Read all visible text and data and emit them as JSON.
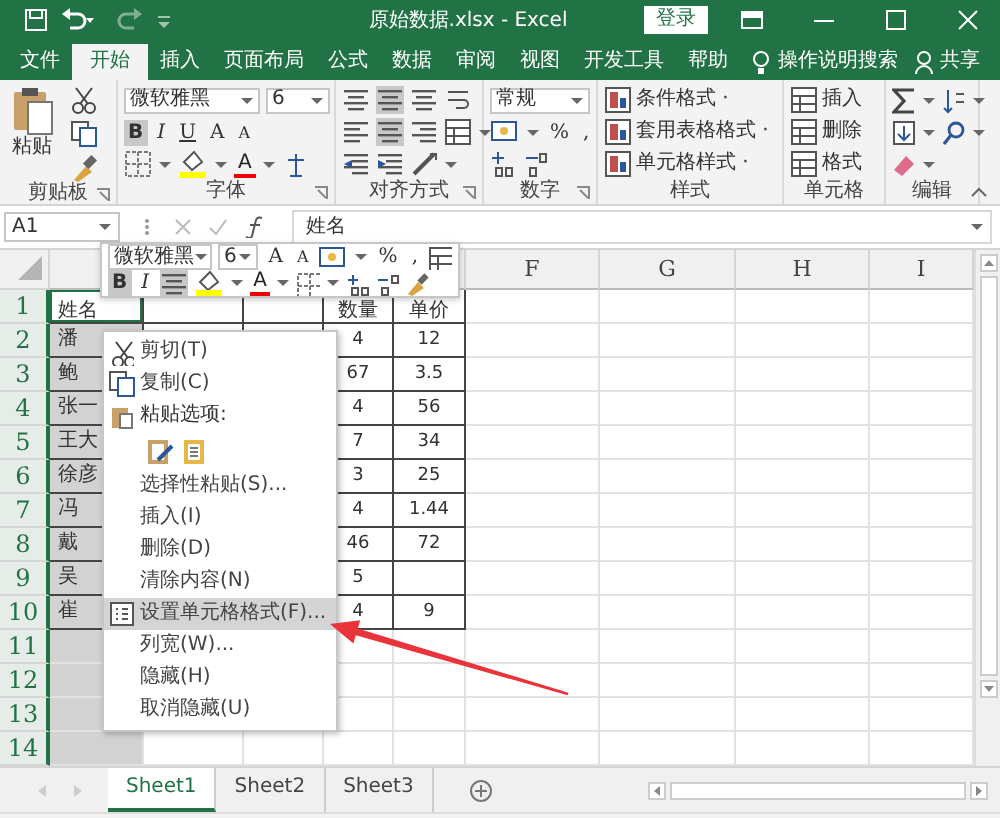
{
  "window": {
    "title": "原始数据.xlsx - Excel",
    "login_button": "登录"
  },
  "menu_tabs": [
    {
      "label": "文件",
      "selected": false
    },
    {
      "label": "开始",
      "selected": true
    },
    {
      "label": "插入",
      "selected": false
    },
    {
      "label": "页面布局",
      "selected": false
    },
    {
      "label": "公式",
      "selected": false
    },
    {
      "label": "数据",
      "selected": false
    },
    {
      "label": "审阅",
      "selected": false
    },
    {
      "label": "视图",
      "selected": false
    },
    {
      "label": "开发工具",
      "selected": false
    },
    {
      "label": "帮助",
      "selected": false
    }
  ],
  "search": {
    "label": "操作说明搜索"
  },
  "share": {
    "label": "共享"
  },
  "ribbon": {
    "groups": [
      {
        "kind": "clipboard",
        "label": "剪贴板",
        "paste": "粘贴"
      },
      {
        "kind": "font",
        "label": "字体",
        "font": "微软雅黑",
        "size": "6",
        "styles": [
          {
            "label": "B",
            "selected": true
          },
          {
            "label": "I",
            "selected": false
          },
          {
            "label": "U",
            "selected": false
          }
        ],
        "grow": "A",
        "shrink": "A",
        "color_letter": "A"
      },
      {
        "kind": "align",
        "label": "对齐方式"
      },
      {
        "kind": "number",
        "label": "数字",
        "format": "常规",
        "percent": "%",
        "comma": ","
      },
      {
        "kind": "styles",
        "label": "样式",
        "items": [
          "条件格式 ·",
          "套用表格格式 ·",
          "单元格样式 ·"
        ]
      },
      {
        "kind": "cells",
        "label": "单元格",
        "items": [
          "插入",
          "删除",
          "格式"
        ]
      },
      {
        "kind": "edit",
        "label": "编辑"
      }
    ]
  },
  "formula_bar": {
    "name_box": "A1",
    "value": "姓名"
  },
  "visible_column_headers": [
    "F",
    "G",
    "H",
    "I"
  ],
  "rows": [
    {
      "header": "1",
      "cells": [
        "姓名",
        null,
        null,
        "数量",
        "单价"
      ]
    },
    {
      "header": "2",
      "cells": [
        "潘",
        null,
        null,
        "4",
        "12"
      ]
    },
    {
      "header": "3",
      "cells": [
        "鲍",
        null,
        null,
        "67",
        "3.5"
      ]
    },
    {
      "header": "4",
      "cells": [
        "张一",
        null,
        null,
        "4",
        "56"
      ]
    },
    {
      "header": "5",
      "cells": [
        "王大",
        null,
        null,
        "7",
        "34"
      ]
    },
    {
      "header": "6",
      "cells": [
        "徐彦",
        null,
        null,
        "3",
        "25"
      ]
    },
    {
      "header": "7",
      "cells": [
        "冯",
        null,
        null,
        "4",
        "1.44"
      ]
    },
    {
      "header": "8",
      "cells": [
        "戴",
        null,
        null,
        "46",
        "72"
      ]
    },
    {
      "header": "9",
      "cells": [
        "吴",
        null,
        null,
        "5",
        null
      ]
    },
    {
      "header": "10",
      "cells": [
        "崔",
        null,
        null,
        "4",
        "9"
      ]
    },
    {
      "header": "11"
    },
    {
      "header": "12"
    },
    {
      "header": "13"
    },
    {
      "header": "14"
    }
  ],
  "mini_toolbar": {
    "font": "微软雅黑",
    "size": "6",
    "grow": "A",
    "shrink": "A",
    "percent": "%",
    "comma": ",",
    "bold": {
      "label": "B",
      "selected": true
    },
    "italic": {
      "label": "I",
      "selected": false
    },
    "center_selected": true,
    "color_letter": "A"
  },
  "context_menu": [
    {
      "kind": "item",
      "label": "剪切(T)",
      "selected": false
    },
    {
      "kind": "item",
      "label": "复制(C)",
      "selected": false
    },
    {
      "kind": "heading",
      "label": "粘贴选项:",
      "selected": false
    },
    {
      "kind": "paste_options",
      "selected": false
    },
    {
      "kind": "item",
      "label": "选择性粘贴(S)...",
      "selected": false
    },
    {
      "kind": "item",
      "label": "插入(I)",
      "selected": false
    },
    {
      "kind": "item",
      "label": "删除(D)",
      "selected": false
    },
    {
      "kind": "item",
      "label": "清除内容(N)",
      "selected": false
    },
    {
      "kind": "item",
      "label": "设置单元格格式(F)...",
      "selected": true
    },
    {
      "kind": "item",
      "label": "列宽(W)...",
      "selected": false
    },
    {
      "kind": "item",
      "label": "隐藏(H)",
      "selected": false
    },
    {
      "kind": "item",
      "label": "取消隐藏(U)",
      "selected": false
    }
  ],
  "sheet_tabs": [
    {
      "label": "Sheet1",
      "selected": true
    },
    {
      "label": "Sheet2",
      "selected": false
    },
    {
      "label": "Sheet3",
      "selected": false
    }
  ]
}
